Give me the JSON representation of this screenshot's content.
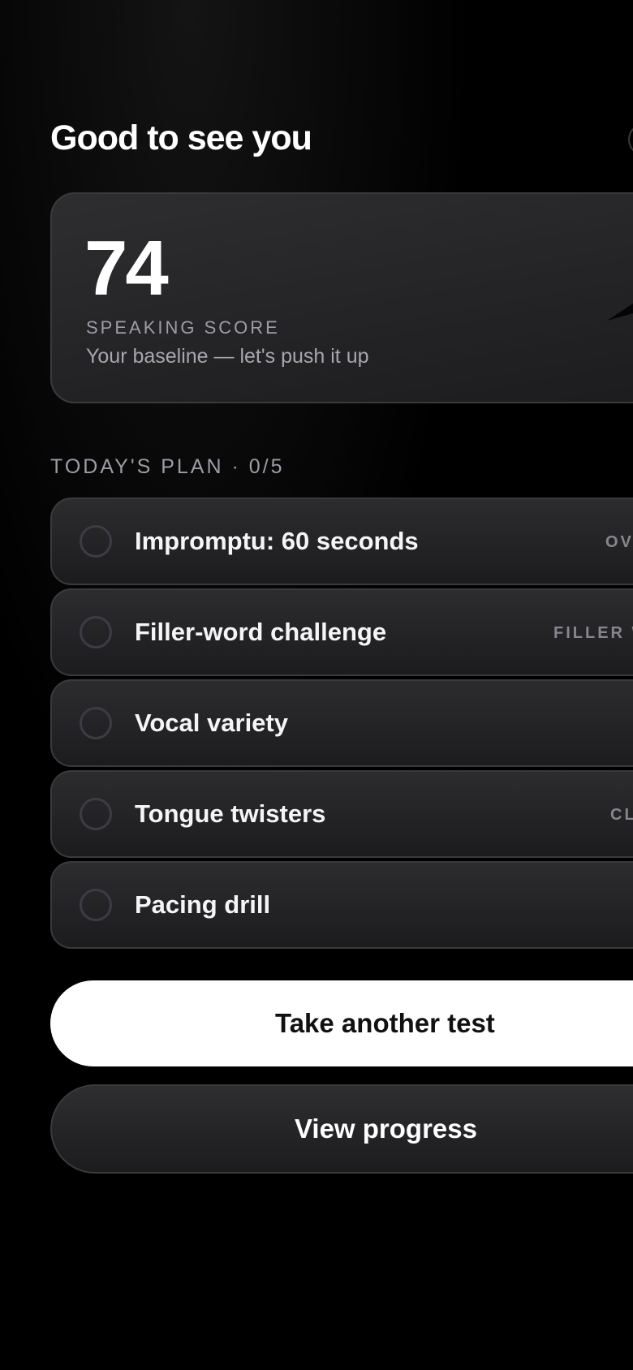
{
  "header": {
    "greeting": "Good to see you"
  },
  "score_card": {
    "score": "74",
    "label": "SPEAKING SCORE",
    "subtitle": "Your baseline — let's push it up",
    "icon": "trend-arrow-icon"
  },
  "plan": {
    "header": "TODAY'S PLAN · 0/5",
    "completed": 0,
    "total": 5,
    "items": [
      {
        "title": "Impromptu: 60 seconds",
        "tag": "OV",
        "done": false
      },
      {
        "title": "Filler-word challenge",
        "tag": "FILLER W",
        "done": false
      },
      {
        "title": "Vocal variety",
        "tag": "",
        "done": false
      },
      {
        "title": "Tongue twisters",
        "tag": "CL",
        "done": false
      },
      {
        "title": "Pacing drill",
        "tag": "",
        "done": false
      }
    ]
  },
  "actions": {
    "primary_label": "Take another test",
    "secondary_label": "View progress"
  },
  "colors": {
    "background": "#000000",
    "card": "#1c1c1e",
    "muted_text": "#9d9da8",
    "primary_button": "#ffffff"
  }
}
